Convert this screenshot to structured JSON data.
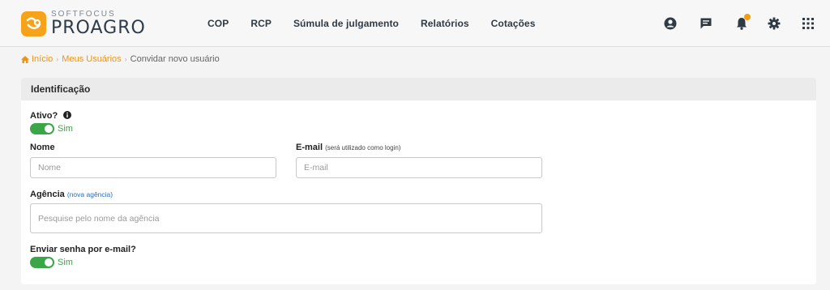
{
  "brand": {
    "small": "SOFTFOCUS",
    "name": "PROAGRO"
  },
  "nav": [
    "COP",
    "RCP",
    "Súmula de julgamento",
    "Relatórios",
    "Cotações"
  ],
  "breadcrumb": {
    "home": "Início",
    "users": "Meus Usuários",
    "current": "Convidar novo usuário"
  },
  "section_title": "Identificação",
  "form": {
    "active_label": "Ativo?",
    "active_value": "Sim",
    "name_label": "Nome",
    "name_placeholder": "Nome",
    "email_label": "E-mail",
    "email_hint": "(será utilizado como login)",
    "email_placeholder": "E-mail",
    "agency_label": "Agência",
    "agency_link": "(nova agência)",
    "agency_placeholder": "Pesquise pelo nome da agência",
    "send_password_label": "Enviar senha por e-mail?",
    "send_password_value": "Sim"
  },
  "colors": {
    "accent": "#f6a21a",
    "toggle_on": "#3aa647",
    "link": "#2a6ebb",
    "notification": "#f39c12"
  },
  "icons": [
    "user-circle-icon",
    "chat-icon",
    "bell-icon",
    "gear-icon",
    "apps-grid-icon"
  ]
}
